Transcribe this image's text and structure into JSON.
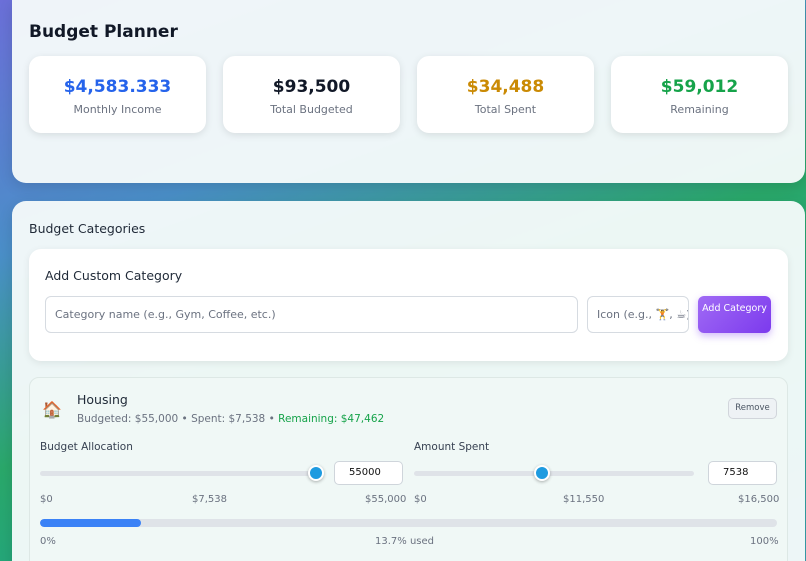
{
  "header": {
    "title": "Budget Planner"
  },
  "stats": [
    {
      "value": "$4,583.333",
      "label": "Monthly Income",
      "color": "#2563eb"
    },
    {
      "value": "$93,500",
      "label": "Total Budgeted",
      "color": "#111827"
    },
    {
      "value": "$34,488",
      "label": "Total Spent",
      "color": "#ca8a04"
    },
    {
      "value": "$59,012",
      "label": "Remaining",
      "color": "#16a34a"
    }
  ],
  "categories_section": {
    "title": "Budget Categories",
    "add": {
      "title": "Add Custom Category",
      "name_placeholder": "Category name (e.g., Gym, Coffee, etc.)",
      "icon_placeholder": "Icon (e.g., 🏋️, ☕)",
      "button_label": "Add Category"
    }
  },
  "category": {
    "icon": "house-icon",
    "icon_glyph": "🏠",
    "name": "Housing",
    "budgeted_text": "Budgeted: $55,000",
    "sep1": " • ",
    "spent_text": "Spent: $7,538",
    "sep2": " • ",
    "remaining_text": "Remaining: $47,462",
    "remove_label": "Remove",
    "allocation": {
      "label": "Budget Allocation",
      "value": "55000",
      "fraction": 1.0,
      "ticks": [
        "$0",
        "$7,538",
        "$55,000"
      ]
    },
    "spent": {
      "label": "Amount Spent",
      "value": "7538",
      "fraction": 0.457,
      "ticks": [
        "$0",
        "$11,550",
        "$16,500"
      ]
    },
    "progress": {
      "fraction": 0.137,
      "min_label": "0%",
      "used_label": "13.7% used",
      "max_label": "100%"
    }
  }
}
